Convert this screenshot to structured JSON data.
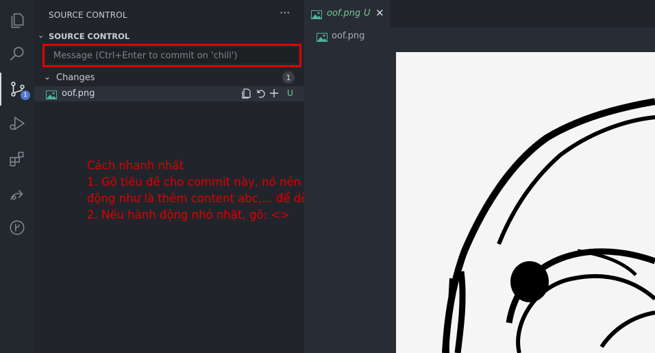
{
  "activity_bar": {
    "items": [
      {
        "name": "explorer-icon"
      },
      {
        "name": "search-icon"
      },
      {
        "name": "source-control-icon",
        "badge": "1"
      },
      {
        "name": "run-debug-icon"
      },
      {
        "name": "extensions-icon"
      },
      {
        "name": "remote-share-icon"
      },
      {
        "name": "git-graph-icon"
      }
    ]
  },
  "sidebar": {
    "title": "SOURCE CONTROL",
    "more": "···",
    "section_title": "SOURCE CONTROL",
    "message_placeholder": "Message (Ctrl+Enter to commit on 'chill')",
    "changes_label": "Changes",
    "changes_count": "1",
    "file": {
      "name": "oof.png",
      "status": "U"
    }
  },
  "annotation": {
    "text": "Cách nhanh nhất\n1. Gõ tiêu đề cho commit này, nó nên là tên của hành động như là thêm content abc,... để dễ hiểu lại code.\n2. Nếu hành động nhỏ nhặt, gõ: <>",
    "color": "#e00000"
  },
  "editor": {
    "tab": {
      "name": "oof.png",
      "status": "U",
      "close": "✕"
    },
    "breadcrumb": "oof.png"
  },
  "colors": {
    "untracked": "#73c991",
    "badge": "#4d78cc",
    "highlight_box": "#e00000"
  }
}
